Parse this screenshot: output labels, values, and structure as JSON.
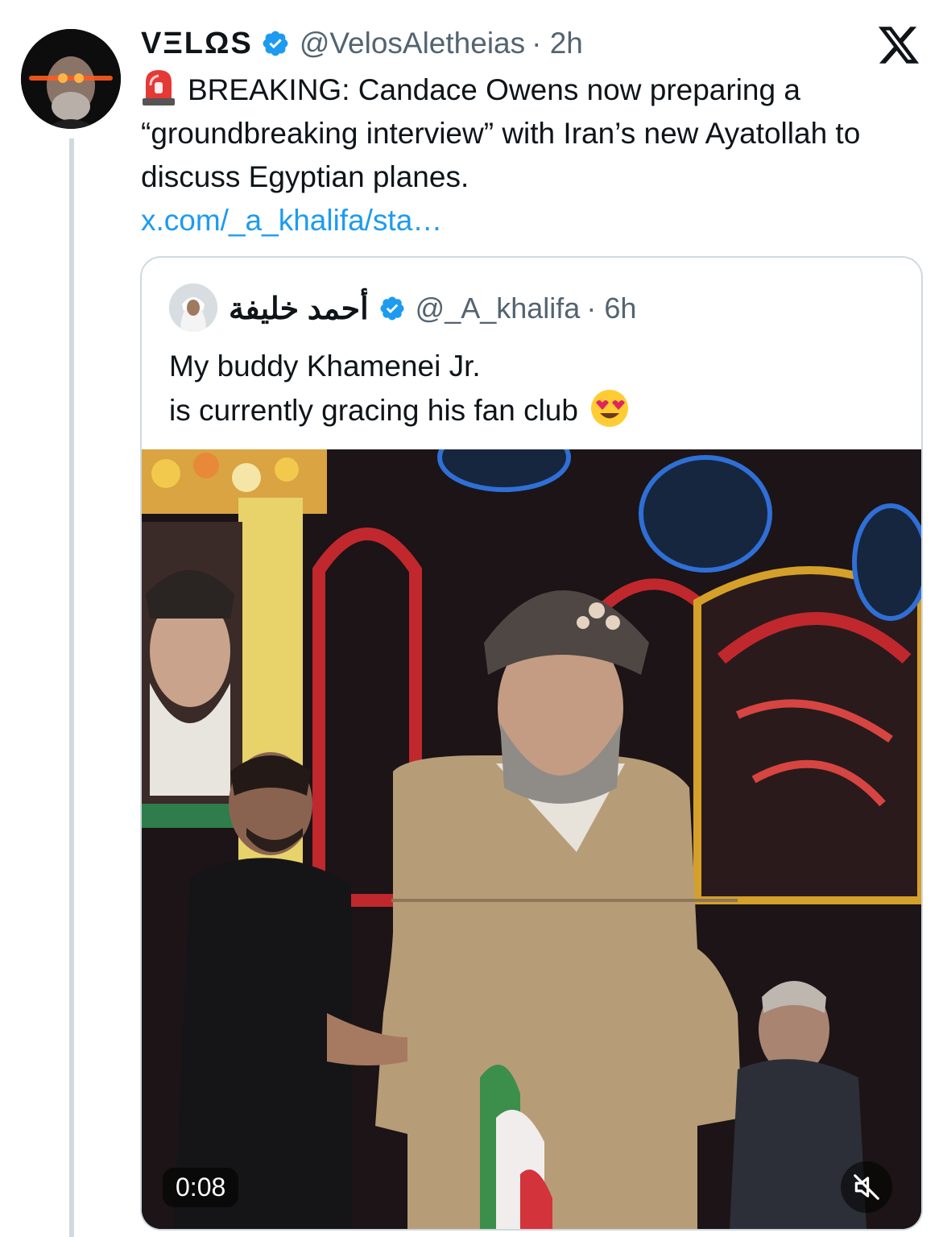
{
  "post": {
    "display_name": "VΞLΩS",
    "handle": "@VelosAletheias",
    "time": "· 2h",
    "text": "BREAKING: Candace Owens now preparing a “groundbreaking interview” with Iran’s new Ayatollah to discuss Egyptian planes.",
    "link": "x.com/_a_khalifa/sta…",
    "icons": [
      "siren-emoji",
      "verified-badge",
      "x-logo"
    ]
  },
  "quote": {
    "display_name": "أحمد خليفة",
    "handle": "@_A_khalifa",
    "time": "· 6h",
    "text_line1": "My buddy Khamenei Jr.",
    "text_line2": "is currently gracing his fan club",
    "video": {
      "duration": "0:08",
      "muted": true
    }
  },
  "colors": {
    "link": "#1d9bf0",
    "verified": "#1d9bf0",
    "secondary_text": "#536471",
    "border": "#cfd9de"
  }
}
